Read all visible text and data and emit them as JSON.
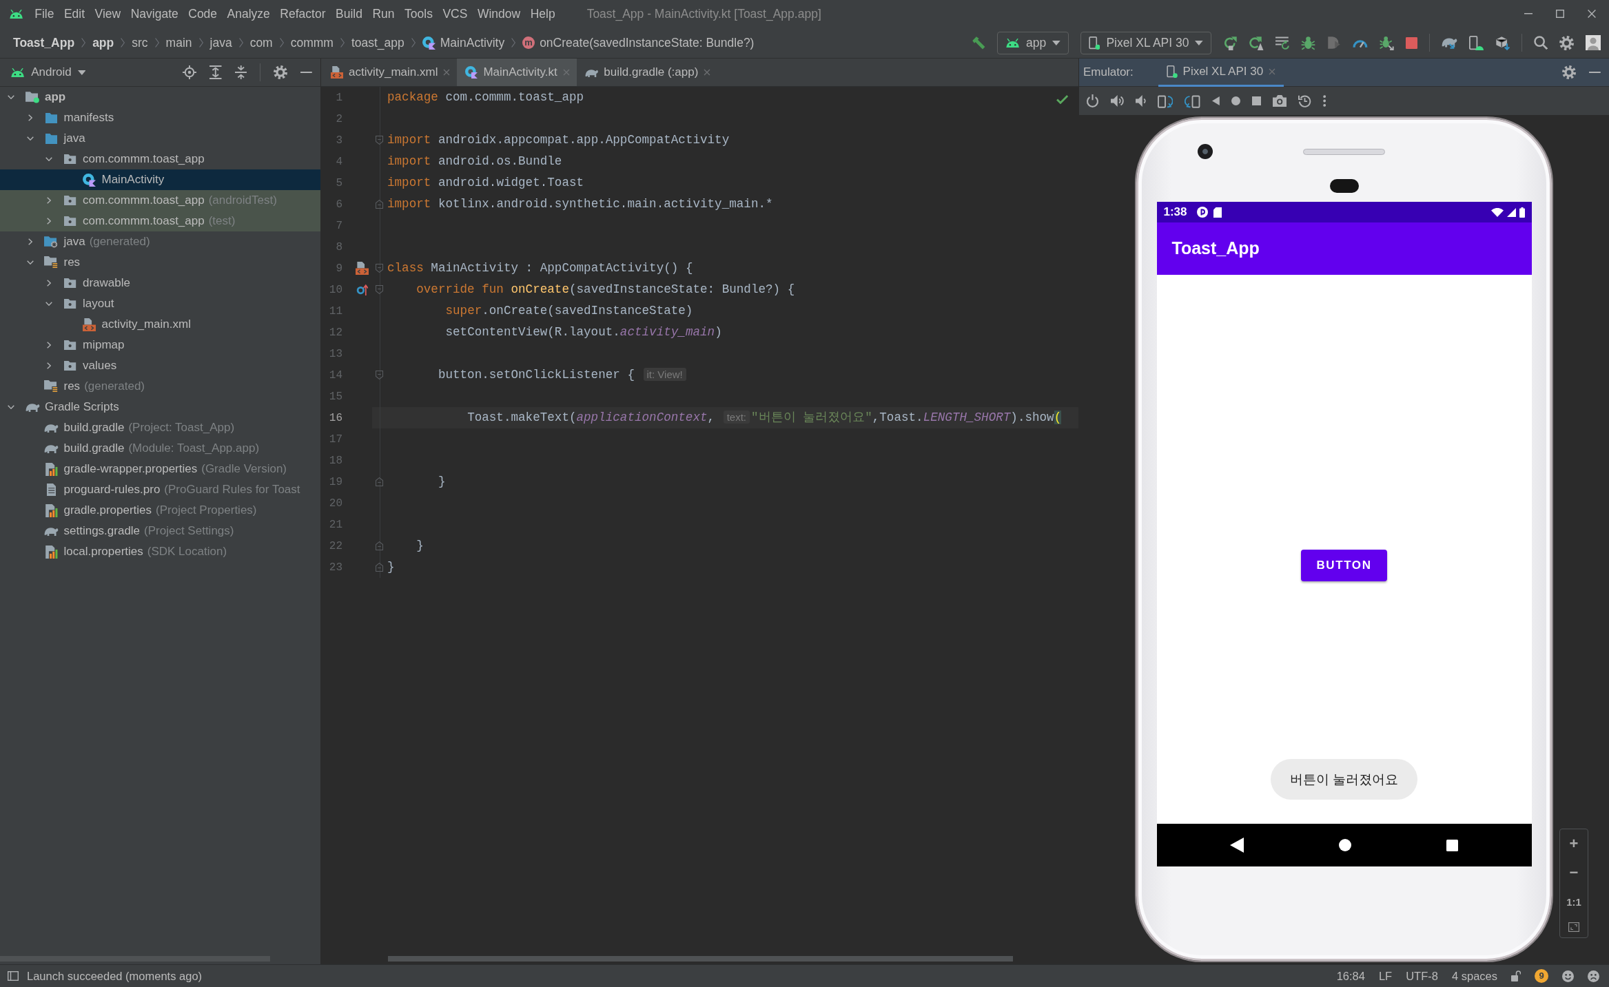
{
  "menu_bar": {
    "items": [
      "File",
      "Edit",
      "View",
      "Navigate",
      "Code",
      "Analyze",
      "Refactor",
      "Build",
      "Run",
      "Tools",
      "VCS",
      "Window",
      "Help"
    ],
    "title": "Toast_App - MainActivity.kt [Toast_App.app]"
  },
  "breadcrumbs": [
    {
      "label": "Toast_App",
      "kind": "module"
    },
    {
      "label": "app",
      "kind": "module"
    },
    {
      "label": "src",
      "kind": "dir"
    },
    {
      "label": "main",
      "kind": "dir"
    },
    {
      "label": "java",
      "kind": "dir"
    },
    {
      "label": "com",
      "kind": "dir"
    },
    {
      "label": "commm",
      "kind": "dir"
    },
    {
      "label": "toast_app",
      "kind": "dir"
    },
    {
      "label": "MainActivity",
      "kind": "class"
    },
    {
      "label": "onCreate(savedInstanceState: Bundle?)",
      "kind": "method",
      "badge": "m"
    }
  ],
  "toolbar": {
    "run_config": "app",
    "device": "Pixel XL API 30"
  },
  "project": {
    "view": "Android",
    "tree": [
      {
        "label": "app",
        "kind": "module",
        "expanded": true,
        "selected": false,
        "tinted": false,
        "children": [
          {
            "label": "manifests",
            "kind": "source",
            "expanded": false,
            "selected": false,
            "tinted": false
          },
          {
            "label": "java",
            "kind": "source",
            "expanded": true,
            "selected": false,
            "tinted": false,
            "children": [
              {
                "label": "com.commm.toast_app",
                "kind": "package",
                "expanded": true,
                "selected": false,
                "tinted": false,
                "children": [
                  {
                    "label": "MainActivity",
                    "kind": "kotlin",
                    "selected": true,
                    "tinted": false
                  }
                ]
              },
              {
                "label": "com.commm.toast_app",
                "hint": "(androidTest)",
                "kind": "package",
                "expanded": false,
                "selected": false,
                "tinted": true
              },
              {
                "label": "com.commm.toast_app",
                "hint": "(test)",
                "kind": "package",
                "expanded": false,
                "selected": false,
                "tinted": true
              }
            ]
          },
          {
            "label": "java",
            "hint": "(generated)",
            "kind": "generated",
            "expanded": false,
            "selected": false,
            "tinted": false
          },
          {
            "label": "res",
            "kind": "res",
            "expanded": true,
            "selected": false,
            "tinted": false,
            "children": [
              {
                "label": "drawable",
                "kind": "package",
                "expanded": false,
                "selected": false,
                "tinted": false
              },
              {
                "label": "layout",
                "kind": "package",
                "expanded": true,
                "selected": false,
                "tinted": false,
                "children": [
                  {
                    "label": "activity_main.xml",
                    "kind": "xml",
                    "selected": false,
                    "tinted": false
                  }
                ]
              },
              {
                "label": "mipmap",
                "kind": "package",
                "expanded": false,
                "selected": false,
                "tinted": false
              },
              {
                "label": "values",
                "kind": "package",
                "expanded": false,
                "selected": false,
                "tinted": false
              }
            ]
          },
          {
            "label": "res",
            "hint": "(generated)",
            "kind": "res",
            "selected": false,
            "tinted": false
          }
        ]
      },
      {
        "label": "Gradle Scripts",
        "kind": "gradle",
        "expanded": true,
        "selected": false,
        "tinted": false,
        "children": [
          {
            "label": "build.gradle",
            "hint": "(Project: Toast_App)",
            "kind": "gradle",
            "selected": false,
            "tinted": false
          },
          {
            "label": "build.gradle",
            "hint": "(Module: Toast_App.app)",
            "kind": "gradle",
            "selected": false,
            "tinted": false
          },
          {
            "label": "gradle-wrapper.properties",
            "hint": "(Gradle Version)",
            "kind": "properties",
            "selected": false,
            "tinted": false
          },
          {
            "label": "proguard-rules.pro",
            "hint": "(ProGuard Rules for Toast",
            "kind": "text",
            "selected": false,
            "tinted": false
          },
          {
            "label": "gradle.properties",
            "hint": "(Project Properties)",
            "kind": "properties",
            "selected": false,
            "tinted": false
          },
          {
            "label": "settings.gradle",
            "hint": "(Project Settings)",
            "kind": "gradle",
            "selected": false,
            "tinted": false
          },
          {
            "label": "local.properties",
            "hint": "(SDK Location)",
            "kind": "properties",
            "selected": false,
            "tinted": false
          }
        ]
      }
    ]
  },
  "editor": {
    "tabs": [
      {
        "label": "activity_main.xml",
        "kind": "xml",
        "selected": false
      },
      {
        "label": "MainActivity.kt",
        "kind": "kotlin",
        "selected": true
      },
      {
        "label": "build.gradle (:app)",
        "kind": "gradle",
        "selected": false
      }
    ],
    "lines": [
      {
        "number": "1",
        "current": false,
        "tokens": [
          {
            "text": "package",
            "kind": "keyword"
          },
          {
            "text": " com.commm.toast_app",
            "kind": "plain"
          }
        ]
      },
      {
        "number": "2",
        "current": false
      },
      {
        "number": "3",
        "current": false,
        "fold": {
          "kind": "open"
        },
        "tokens": [
          {
            "text": "import",
            "kind": "keyword"
          },
          {
            "text": " androidx.appcompat.app.AppCompatActivity",
            "kind": "plain"
          }
        ]
      },
      {
        "number": "4",
        "current": false,
        "tokens": [
          {
            "text": "import",
            "kind": "keyword"
          },
          {
            "text": " android.os.Bundle",
            "kind": "plain"
          }
        ]
      },
      {
        "number": "5",
        "current": false,
        "tokens": [
          {
            "text": "import",
            "kind": "keyword"
          },
          {
            "text": " android.widget.Toast",
            "kind": "plain"
          }
        ]
      },
      {
        "number": "6",
        "current": false,
        "fold": {
          "kind": "close"
        },
        "tokens": [
          {
            "text": "import",
            "kind": "keyword"
          },
          {
            "text": " kotlinx.android.synthetic.main.activity_main.*",
            "kind": "plain"
          }
        ]
      },
      {
        "number": "7",
        "current": false
      },
      {
        "number": "8",
        "current": false
      },
      {
        "number": "9",
        "current": false,
        "fold": {
          "kind": "open"
        },
        "gutter_icon": {
          "kind": "layout"
        },
        "tokens": [
          {
            "text": "class",
            "kind": "keyword"
          },
          {
            "text": " MainActivity : AppCompatActivity() {",
            "kind": "plain"
          }
        ]
      },
      {
        "number": "10",
        "current": false,
        "fold": {
          "kind": "open"
        },
        "gutter_icon": {
          "kind": "override"
        },
        "tokens": [
          {
            "text": "    override fun ",
            "kind": "keyword"
          },
          {
            "text": "onCreate",
            "kind": "decl"
          },
          {
            "text": "(savedInstanceState: Bundle?) {",
            "kind": "plain"
          }
        ]
      },
      {
        "number": "11",
        "current": false,
        "tokens": [
          {
            "text": "        super",
            "kind": "keyword"
          },
          {
            "text": ".onCreate(savedInstanceState)",
            "kind": "plain"
          }
        ]
      },
      {
        "number": "12",
        "current": false,
        "tokens": [
          {
            "text": "        setContentView(R.layout.",
            "kind": "plain"
          },
          {
            "text": "activity_main",
            "kind": "field"
          },
          {
            "text": ")",
            "kind": "plain"
          }
        ]
      },
      {
        "number": "13",
        "current": false
      },
      {
        "number": "14",
        "current": false,
        "fold": {
          "kind": "open"
        },
        "tokens": [
          {
            "text": "       button.setOnClickListener { ",
            "kind": "plain"
          },
          {
            "text": "it: View!",
            "kind": "hint"
          }
        ]
      },
      {
        "number": "15",
        "current": false
      },
      {
        "number": "16",
        "current": true,
        "tokens": [
          {
            "text": "           Toast.makeText(",
            "kind": "plain"
          },
          {
            "text": "applicationContext",
            "kind": "field"
          },
          {
            "text": ", ",
            "kind": "plain"
          },
          {
            "text": "text:",
            "kind": "hint"
          },
          {
            "text": "\"버튼이 눌러졌어요\"",
            "kind": "string"
          },
          {
            "text": ",Toast.",
            "kind": "plain"
          },
          {
            "text": "LENGTH_SHORT",
            "kind": "field"
          },
          {
            "text": ").show",
            "kind": "plain"
          },
          {
            "text": "(",
            "kind": "match"
          }
        ]
      },
      {
        "number": "17",
        "current": false
      },
      {
        "number": "18",
        "current": false
      },
      {
        "number": "19",
        "current": false,
        "fold": {
          "kind": "close"
        },
        "tokens": [
          {
            "text": "       }",
            "kind": "plain"
          }
        ]
      },
      {
        "number": "20",
        "current": false
      },
      {
        "number": "21",
        "current": false
      },
      {
        "number": "22",
        "current": false,
        "fold": {
          "kind": "close"
        },
        "tokens": [
          {
            "text": "    }",
            "kind": "plain"
          }
        ]
      },
      {
        "number": "23",
        "current": false,
        "fold": {
          "kind": "close"
        },
        "tokens": [
          {
            "text": "}",
            "kind": "plain"
          }
        ]
      }
    ]
  },
  "emulator": {
    "label": "Emulator:",
    "tabs": [
      {
        "label": "Pixel XL API 30",
        "selected": true
      }
    ],
    "phone": {
      "time": "1:38",
      "app_title": "Toast_App",
      "button": "BUTTON",
      "toast": "버튼이 눌러졌어요"
    },
    "zoom_controls": [
      "+",
      "−",
      "1:1"
    ]
  },
  "status_bar": {
    "message": "Launch succeeded (moments ago)",
    "items": [
      "16:84",
      "LF",
      "UTF-8",
      "4 spaces"
    ],
    "notifications": "9"
  }
}
